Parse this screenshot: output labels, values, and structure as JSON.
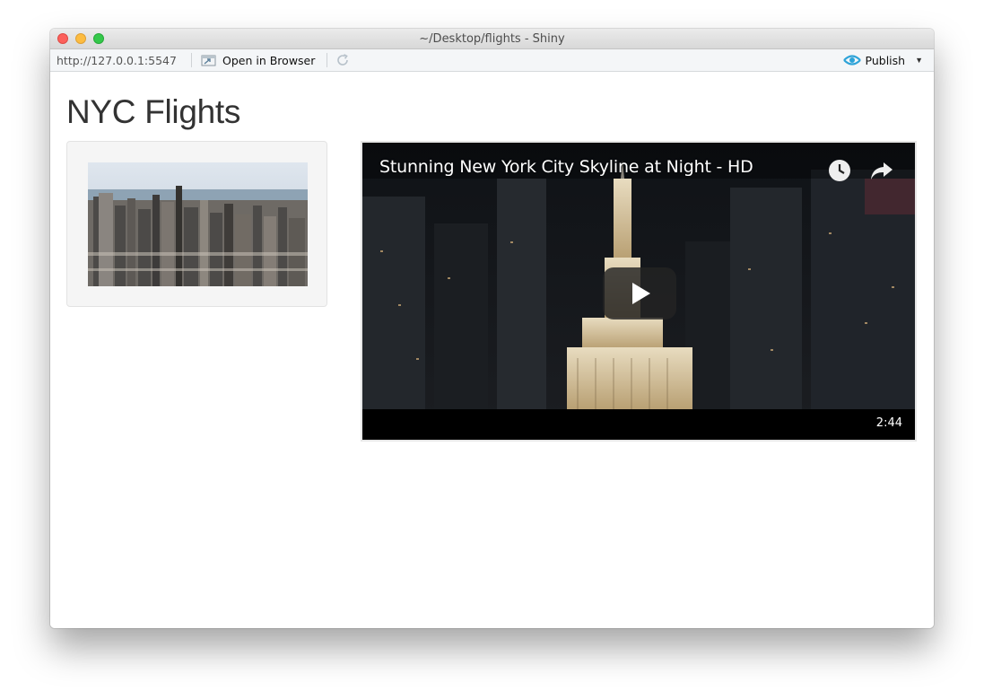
{
  "window": {
    "title": "~/Desktop/flights - Shiny"
  },
  "toolbar": {
    "url": "http://127.0.0.1:5547",
    "open_browser_label": "Open in Browser",
    "publish_label": "Publish",
    "open_icon": "open-in-browser-icon",
    "refresh_icon": "refresh-icon",
    "publish_icon": "publish-icon",
    "accent_color": "#2ea3d8"
  },
  "page": {
    "heading": "NYC Flights"
  },
  "sidebar": {
    "image_subject": "Manhattan skyline aerial photo"
  },
  "video": {
    "title": "Stunning New York City Skyline at Night - HD",
    "duration": "2:44",
    "watch_later_icon": "clock-icon",
    "share_icon": "share-arrow-icon",
    "play_icon": "play-icon"
  }
}
